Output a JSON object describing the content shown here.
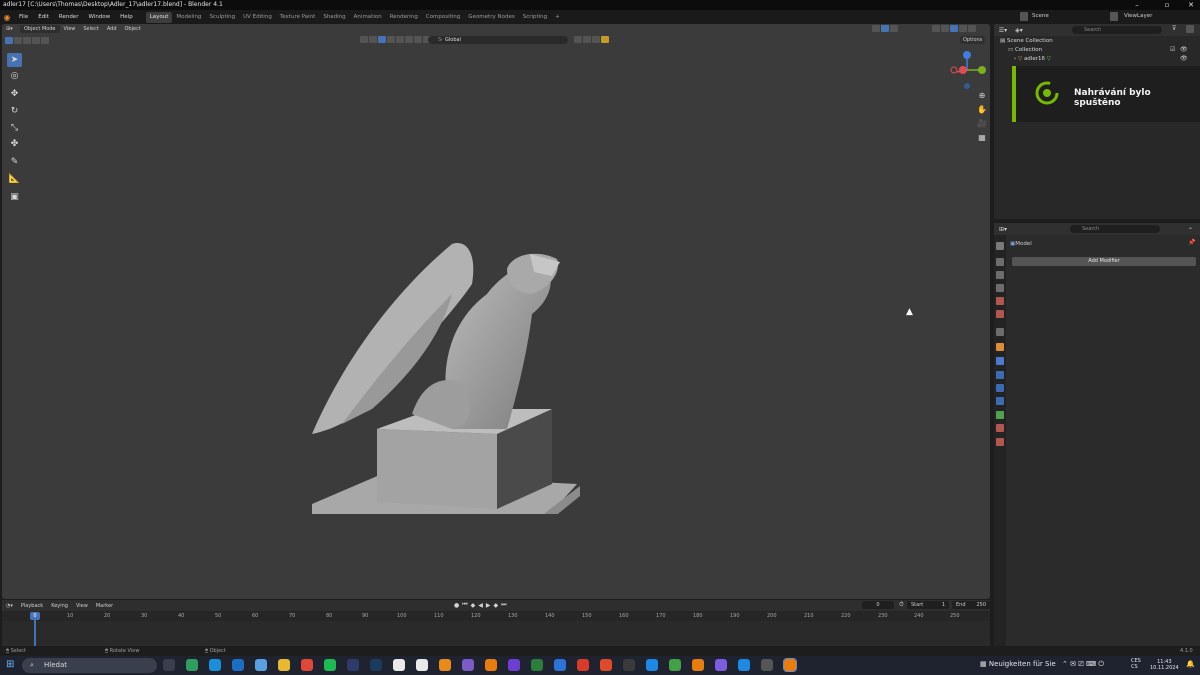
{
  "window": {
    "title": "adler17 [C:\\Users\\Thomas\\Desktop\\Adler_17\\adler17.blend] - Blender 4.1"
  },
  "menu": {
    "items": [
      "File",
      "Edit",
      "Render",
      "Window",
      "Help"
    ]
  },
  "workspaces": {
    "tabs": [
      "Layout",
      "Modeling",
      "Sculpting",
      "UV Editing",
      "Texture Paint",
      "Shading",
      "Animation",
      "Rendering",
      "Compositing",
      "Geometry Nodes",
      "Scripting"
    ],
    "add": "+"
  },
  "scene": {
    "label": "Scene",
    "view_layer": "ViewLayer"
  },
  "viewport": {
    "mode": "Object Mode",
    "menus": [
      "View",
      "Select",
      "Add",
      "Object"
    ],
    "transform_orientation": "Global",
    "search_placeholder": "Search",
    "options": "Options"
  },
  "outliner": {
    "search_placeholder": "Search",
    "scene_collection": "Scene Collection",
    "collection": "Collection",
    "object": "adler16"
  },
  "notification": {
    "text": "Nahrávání bylo spuštěno"
  },
  "properties": {
    "search_placeholder": "Search",
    "object": "Model",
    "add_modifier": "Add Modifier"
  },
  "timeline": {
    "menus": [
      "Playback",
      "Keying",
      "View",
      "Marker"
    ],
    "current_frame": "0",
    "start_label": "Start",
    "start": "1",
    "end_label": "End",
    "end": "250",
    "playhead": "0",
    "ticks": [
      "10",
      "20",
      "30",
      "40",
      "50",
      "60",
      "70",
      "80",
      "90",
      "100",
      "110",
      "120",
      "130",
      "140",
      "150",
      "160",
      "170",
      "180",
      "190",
      "200",
      "210",
      "220",
      "230",
      "240",
      "250"
    ]
  },
  "status": {
    "select": "Select",
    "rotate": "Rotate View",
    "object": "Object",
    "version": "4.1.0"
  },
  "taskbar": {
    "search": "Hledat",
    "news": "Neuigkeiten für Sie",
    "lang1": "CES",
    "lang2": "CS",
    "time": "11:43",
    "date": "10.11.2024"
  },
  "colors": {
    "accent": "#4772b3",
    "nvidia": "#76b900",
    "viewport_bg": "#3b3b3b"
  }
}
